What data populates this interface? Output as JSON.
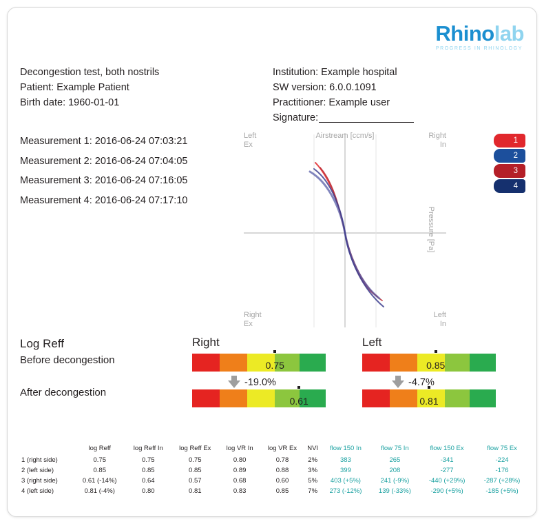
{
  "logo": {
    "part1": "Rhino",
    "part2": "lab",
    "tagline": "PROGRESS IN RHINOLOGY"
  },
  "header": {
    "left": [
      "Decongestion test, both nostrils",
      "Patient: Example Patient",
      "Birth date: 1960-01-01"
    ],
    "right": [
      "Institution: Example hospital",
      "SW version: 6.0.0.1091",
      "Practitioner: Example user"
    ],
    "signature_label": "Signature:"
  },
  "measurements": [
    "Measurement 1: 2016-06-24 07:03:21",
    "Measurement 2: 2016-06-24 07:04:05",
    "Measurement 3: 2016-06-24 07:16:05",
    "Measurement 4: 2016-06-24 07:17:10"
  ],
  "chart_data": {
    "type": "line",
    "title": "",
    "xlabel": "Airstream [ccm/s]",
    "ylabel": "Pressure [Pa]",
    "quadrant_labels": {
      "top_left": "Left\nEx",
      "top_left_l1": "Left",
      "top_left_l2": "Ex",
      "top_center": "Airstream [ccm/s]",
      "top_right_l1": "Right",
      "top_right_l2": "In",
      "bottom_left_l1": "Right",
      "bottom_left_l2": "Ex",
      "bottom_right_l1": "Left",
      "bottom_right_l2": "In",
      "right_axis": "Pressure [Pa]"
    },
    "grid": true,
    "legend_position": "right",
    "series": [
      {
        "name": "1",
        "color": "#e1282d",
        "side": "right",
        "phase": "before"
      },
      {
        "name": "2",
        "color": "#1c4f9c",
        "side": "left",
        "phase": "before"
      },
      {
        "name": "3",
        "color": "#b41f28",
        "side": "right",
        "phase": "after"
      },
      {
        "name": "4",
        "color": "#15306e",
        "side": "left",
        "phase": "after"
      }
    ]
  },
  "legend": [
    {
      "label": "1",
      "color": "#e1282d"
    },
    {
      "label": "2",
      "color": "#1c4f9c"
    },
    {
      "label": "3",
      "color": "#b41f28"
    },
    {
      "label": "4",
      "color": "#15306e"
    }
  ],
  "reff": {
    "title": "Log Reff",
    "before_label": "Before decongestion",
    "after_label": "After decongestion",
    "right": {
      "heading": "Right",
      "before_value": "0.75",
      "after_value": "0.61",
      "delta": "-19.0%",
      "before_pos": 62,
      "after_pos": 80
    },
    "left": {
      "heading": "Left",
      "before_value": "0.85",
      "after_value": "0.81",
      "delta": "-4.7%",
      "before_pos": 55,
      "after_pos": 50
    }
  },
  "table": {
    "columns": [
      "",
      "log Reff",
      "log Reff In",
      "log Reff Ex",
      "log VR In",
      "log VR Ex",
      "NVI",
      "flow 150 In",
      "flow 75 In",
      "flow 150 Ex",
      "flow 75 Ex"
    ],
    "flow_color": "#18a0a0",
    "rows": [
      {
        "label": "1 (right side)",
        "cells": [
          "0.75",
          "0.75",
          "0.75",
          "0.80",
          "0.78",
          "2%"
        ],
        "flows": [
          "383",
          "265",
          "-341",
          "-224"
        ]
      },
      {
        "label": "2 (left side)",
        "cells": [
          "0.85",
          "0.85",
          "0.85",
          "0.89",
          "0.88",
          "3%"
        ],
        "flows": [
          "399",
          "208",
          "-277",
          "-176"
        ]
      },
      {
        "label": "3 (right side)",
        "cells": [
          "0.61 (-14%)",
          "0.64",
          "0.57",
          "0.68",
          "0.60",
          "5%"
        ],
        "flows": [
          "403 (+5%)",
          "241 (-9%)",
          "-440 (+29%)",
          "-287 (+28%)"
        ]
      },
      {
        "label": "4 (left side)",
        "cells": [
          "0.81 (-4%)",
          "0.80",
          "0.81",
          "0.83",
          "0.85",
          "7%"
        ],
        "flows": [
          "273 (-12%)",
          "139 (-33%)",
          "-290 (+5%)",
          "-185 (+5%)"
        ]
      }
    ]
  }
}
